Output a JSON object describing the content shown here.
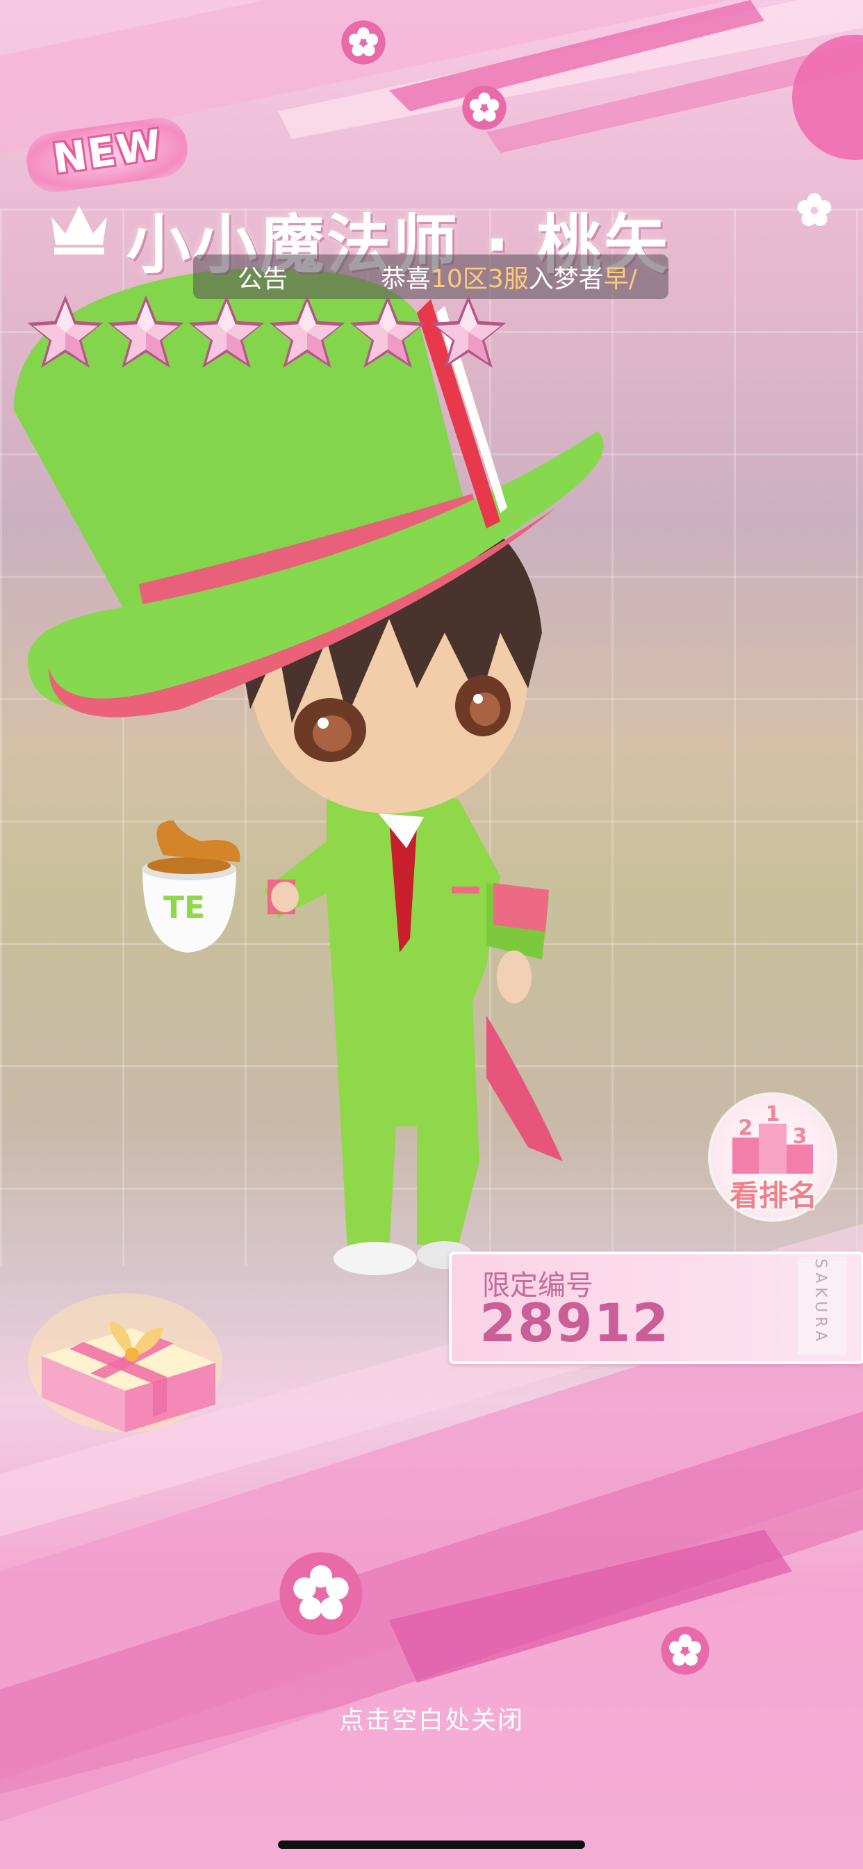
{
  "badge": {
    "new_label": "NEW"
  },
  "card": {
    "title": "小小魔法师 · 桃矢",
    "rarity_stars": 6
  },
  "notice": {
    "label": "公告",
    "message_prefix": "恭喜",
    "message_highlight": "10区3服",
    "message_suffix": "入梦者",
    "message_trail": "早/"
  },
  "ranking": {
    "podium_numbers": [
      "2",
      "1",
      "3"
    ],
    "label": "看排名"
  },
  "limited": {
    "label": "限定编号",
    "number": "28912",
    "brand": "SAKURA"
  },
  "footer": {
    "close_hint": "点击空白处关闭"
  },
  "icons": [
    "crown-icon",
    "star-icon",
    "podium-icon",
    "gift-box-icon",
    "sakura-flower-icon"
  ],
  "colors": {
    "accent_pink": "#e45b98",
    "notice_highlight": "#ffc97c",
    "ticket_text": "#c95f96"
  }
}
